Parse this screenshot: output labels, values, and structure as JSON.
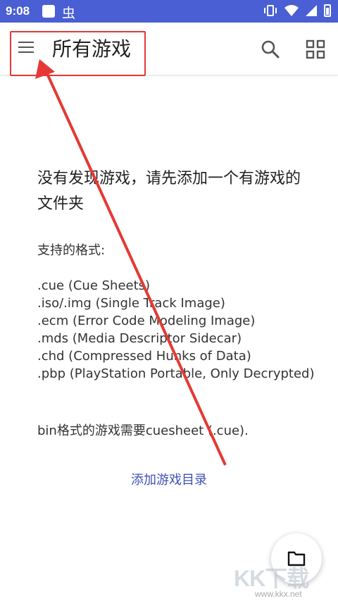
{
  "status_bar": {
    "time": "9:08",
    "bug_glyph": "虫"
  },
  "app_bar": {
    "title": "所有游戏"
  },
  "empty_state": {
    "title": "没有发现游戏，请先添加一个有游戏的文件夹",
    "formats_heading": "支持的格式:",
    "formats": [
      ".cue (Cue Sheets)",
      ".iso/.img (Single Track Image)",
      ".ecm (Error Code Modeling Image)",
      ".mds (Media Descriptor Sidecar)",
      ".chd (Compressed Hunks of Data)",
      ".pbp (PlayStation Portable, Only Decrypted)"
    ],
    "bin_note": "bin格式的游戏需要cuesheet (.cue).",
    "add_button_label": "添加游戏目录"
  },
  "watermark": {
    "logo_text": "KK下载",
    "url": "www.kkx.net"
  },
  "colors": {
    "status_bar": "#4a5fd3",
    "accent": "#3f51b5",
    "annotation": "#e53935"
  }
}
